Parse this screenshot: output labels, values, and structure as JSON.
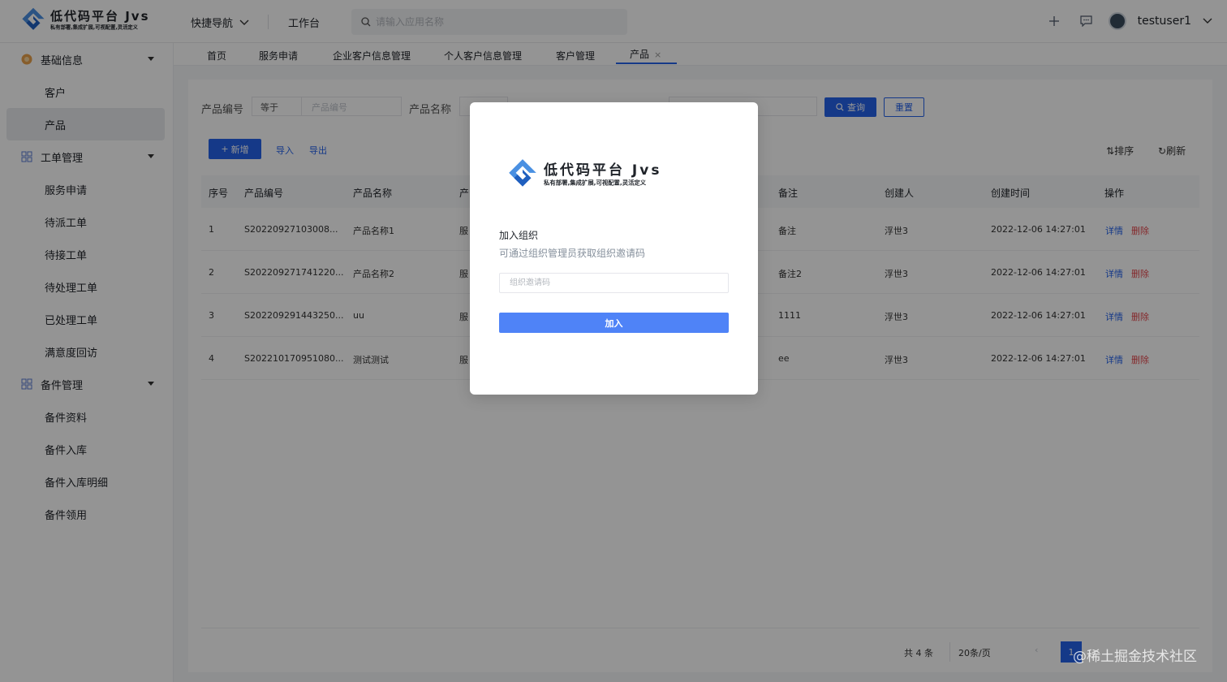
{
  "topbar": {
    "logo_title": "低代码平台 Jvs",
    "logo_sub": "私有部署,集成扩展,可视配置,灵活定义",
    "quick_nav": "快捷导航",
    "workbench": "工作台",
    "search_placeholder": "请输入应用名称",
    "username": "testuser1"
  },
  "sidebar": {
    "groups": [
      {
        "label": "基础信息",
        "items": [
          "客户",
          "产品"
        ]
      },
      {
        "label": "工单管理",
        "items": [
          "服务申请",
          "待派工单",
          "待接工单",
          "待处理工单",
          "已处理工单",
          "满意度回访"
        ]
      },
      {
        "label": "备件管理",
        "items": [
          "备件资料",
          "备件入库",
          "备件入库明细",
          "备件领用"
        ]
      }
    ]
  },
  "tabs": [
    "首页",
    "服务申请",
    "企业客户信息管理",
    "个人客户信息管理",
    "客户管理",
    "产品"
  ],
  "filters": {
    "code_label": "产品编号",
    "code_op": "等于",
    "code_placeholder": "产品编号",
    "name_label": "产品名称",
    "query": "查询",
    "reset": "重置"
  },
  "toolbar": {
    "add": "新增",
    "import": "导入",
    "export": "导出",
    "sort": "排序",
    "refresh": "刷新"
  },
  "table": {
    "headers": [
      "序号",
      "产品编号",
      "产品名称",
      "产",
      "备注",
      "创建人",
      "创建时间",
      "操作"
    ],
    "rows": [
      {
        "idx": "1",
        "code": "S20220927103008...",
        "name": "产品名称1",
        "col4": "服",
        "remark": "备注",
        "creator": "浮世3",
        "time": "2022-12-06 14:27:01"
      },
      {
        "idx": "2",
        "code": "S202209271741220...",
        "name": "产品名称2",
        "col4": "服",
        "remark": "备注2",
        "creator": "浮世3",
        "time": "2022-12-06 14:27:01"
      },
      {
        "idx": "3",
        "code": "S202209291443250...",
        "name": "uu",
        "col4": "服",
        "remark": "1111",
        "creator": "浮世3",
        "time": "2022-12-06 14:27:01"
      },
      {
        "idx": "4",
        "code": "S202210170951080...",
        "name": "测试测试",
        "col4": "服",
        "remark": "ee",
        "creator": "浮世3",
        "time": "2022-12-06 14:27:01"
      }
    ],
    "action_detail": "详情",
    "action_delete": "删除"
  },
  "pager": {
    "total": "共 4 条",
    "size": "20条/页",
    "page": "1"
  },
  "modal": {
    "logo_title": "低代码平台 Jvs",
    "logo_sub": "私有部署,集成扩展,可视配置,灵活定义",
    "title": "加入组织",
    "desc": "可通过组织管理员获取组织邀请码",
    "input_placeholder": "组织邀请码",
    "join": "加入"
  },
  "watermark": "@稀土掘金技术社区",
  "colors": {
    "primary": "#2563eb",
    "modal_button": "#4f83f7",
    "danger": "#e5484d"
  }
}
